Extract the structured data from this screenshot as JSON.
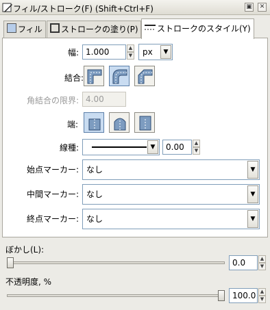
{
  "window": {
    "title": "フィル/ストローク(F) (Shift+Ctrl+F)",
    "menu_glyph": "▣",
    "close_glyph": "✕"
  },
  "tabs": [
    {
      "label": "フィル",
      "active": false
    },
    {
      "label": "ストロークの塗り(P)",
      "active": false
    },
    {
      "label": "ストロークのスタイル(Y)",
      "active": true
    }
  ],
  "style": {
    "width_label": "幅:",
    "width_value": "1.000",
    "unit": "px",
    "join_label": "結合:",
    "join_selected": "round",
    "miter_label": "角結合の限界:",
    "miter_value": "4.00",
    "cap_label": "端:",
    "cap_selected": "butt",
    "dash_label": "線種:",
    "dash_offset": "0.00",
    "start_marker_label": "始点マーカー:",
    "start_marker_value": "なし",
    "mid_marker_label": "中間マーカー:",
    "mid_marker_value": "なし",
    "end_marker_label": "終点マーカー:",
    "end_marker_value": "なし"
  },
  "blur": {
    "label": "ぼかし(L):",
    "value": "0.0",
    "level_percent": 0
  },
  "opacity": {
    "label": "不透明度, %",
    "value": "100.0",
    "level_percent": 100
  }
}
